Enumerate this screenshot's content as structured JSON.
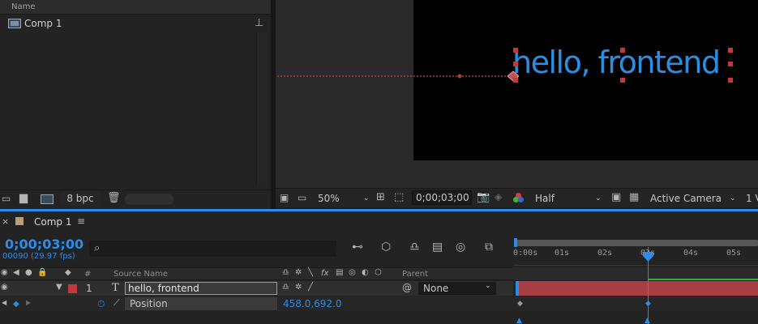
{
  "project": {
    "column_name": "Name",
    "items": [
      {
        "label": "Comp 1"
      }
    ],
    "bpc": "8 bpc"
  },
  "viewer": {
    "text_layer_content": "hello, frontend",
    "zoom": "50%",
    "timecode": "0;00;03;00",
    "resolution": "Half",
    "camera": "Active Camera",
    "views": "1 V"
  },
  "timeline": {
    "tab_label": "Comp 1",
    "current_time": "0;00;03;00",
    "frame_info": "00090 (29.97 fps)",
    "columns": {
      "num": "#",
      "source_name": "Source Name",
      "parent": "Parent"
    },
    "layers": [
      {
        "index": "1",
        "type_glyph": "T",
        "name": "hello, frontend",
        "parent": "None"
      }
    ],
    "property": {
      "name": "Position",
      "value": "458.0,692.0"
    },
    "ruler_ticks": [
      "0:00s",
      "01s",
      "02s",
      "03s",
      "04s",
      "05s"
    ]
  },
  "colors": {
    "accent": "#2d8ceb",
    "layer_label": "#c0393b",
    "text_fill": "#2b8ee0"
  }
}
